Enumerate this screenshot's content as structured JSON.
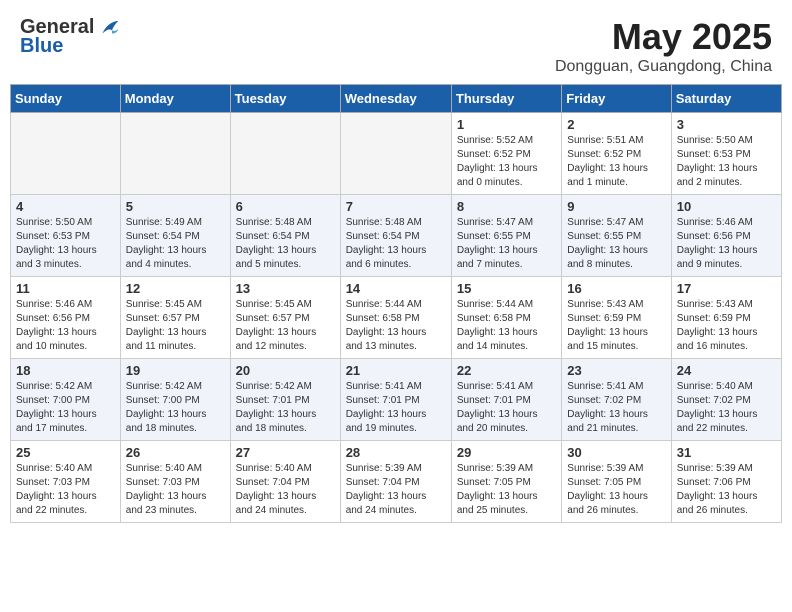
{
  "header": {
    "logo_general": "General",
    "logo_blue": "Blue",
    "month_title": "May 2025",
    "location": "Dongguan, Guangdong, China"
  },
  "days_of_week": [
    "Sunday",
    "Monday",
    "Tuesday",
    "Wednesday",
    "Thursday",
    "Friday",
    "Saturday"
  ],
  "weeks": [
    [
      {
        "day": "",
        "info": ""
      },
      {
        "day": "",
        "info": ""
      },
      {
        "day": "",
        "info": ""
      },
      {
        "day": "",
        "info": ""
      },
      {
        "day": "1",
        "info": "Sunrise: 5:52 AM\nSunset: 6:52 PM\nDaylight: 13 hours\nand 0 minutes."
      },
      {
        "day": "2",
        "info": "Sunrise: 5:51 AM\nSunset: 6:52 PM\nDaylight: 13 hours\nand 1 minute."
      },
      {
        "day": "3",
        "info": "Sunrise: 5:50 AM\nSunset: 6:53 PM\nDaylight: 13 hours\nand 2 minutes."
      }
    ],
    [
      {
        "day": "4",
        "info": "Sunrise: 5:50 AM\nSunset: 6:53 PM\nDaylight: 13 hours\nand 3 minutes."
      },
      {
        "day": "5",
        "info": "Sunrise: 5:49 AM\nSunset: 6:54 PM\nDaylight: 13 hours\nand 4 minutes."
      },
      {
        "day": "6",
        "info": "Sunrise: 5:48 AM\nSunset: 6:54 PM\nDaylight: 13 hours\nand 5 minutes."
      },
      {
        "day": "7",
        "info": "Sunrise: 5:48 AM\nSunset: 6:54 PM\nDaylight: 13 hours\nand 6 minutes."
      },
      {
        "day": "8",
        "info": "Sunrise: 5:47 AM\nSunset: 6:55 PM\nDaylight: 13 hours\nand 7 minutes."
      },
      {
        "day": "9",
        "info": "Sunrise: 5:47 AM\nSunset: 6:55 PM\nDaylight: 13 hours\nand 8 minutes."
      },
      {
        "day": "10",
        "info": "Sunrise: 5:46 AM\nSunset: 6:56 PM\nDaylight: 13 hours\nand 9 minutes."
      }
    ],
    [
      {
        "day": "11",
        "info": "Sunrise: 5:46 AM\nSunset: 6:56 PM\nDaylight: 13 hours\nand 10 minutes."
      },
      {
        "day": "12",
        "info": "Sunrise: 5:45 AM\nSunset: 6:57 PM\nDaylight: 13 hours\nand 11 minutes."
      },
      {
        "day": "13",
        "info": "Sunrise: 5:45 AM\nSunset: 6:57 PM\nDaylight: 13 hours\nand 12 minutes."
      },
      {
        "day": "14",
        "info": "Sunrise: 5:44 AM\nSunset: 6:58 PM\nDaylight: 13 hours\nand 13 minutes."
      },
      {
        "day": "15",
        "info": "Sunrise: 5:44 AM\nSunset: 6:58 PM\nDaylight: 13 hours\nand 14 minutes."
      },
      {
        "day": "16",
        "info": "Sunrise: 5:43 AM\nSunset: 6:59 PM\nDaylight: 13 hours\nand 15 minutes."
      },
      {
        "day": "17",
        "info": "Sunrise: 5:43 AM\nSunset: 6:59 PM\nDaylight: 13 hours\nand 16 minutes."
      }
    ],
    [
      {
        "day": "18",
        "info": "Sunrise: 5:42 AM\nSunset: 7:00 PM\nDaylight: 13 hours\nand 17 minutes."
      },
      {
        "day": "19",
        "info": "Sunrise: 5:42 AM\nSunset: 7:00 PM\nDaylight: 13 hours\nand 18 minutes."
      },
      {
        "day": "20",
        "info": "Sunrise: 5:42 AM\nSunset: 7:01 PM\nDaylight: 13 hours\nand 18 minutes."
      },
      {
        "day": "21",
        "info": "Sunrise: 5:41 AM\nSunset: 7:01 PM\nDaylight: 13 hours\nand 19 minutes."
      },
      {
        "day": "22",
        "info": "Sunrise: 5:41 AM\nSunset: 7:01 PM\nDaylight: 13 hours\nand 20 minutes."
      },
      {
        "day": "23",
        "info": "Sunrise: 5:41 AM\nSunset: 7:02 PM\nDaylight: 13 hours\nand 21 minutes."
      },
      {
        "day": "24",
        "info": "Sunrise: 5:40 AM\nSunset: 7:02 PM\nDaylight: 13 hours\nand 22 minutes."
      }
    ],
    [
      {
        "day": "25",
        "info": "Sunrise: 5:40 AM\nSunset: 7:03 PM\nDaylight: 13 hours\nand 22 minutes."
      },
      {
        "day": "26",
        "info": "Sunrise: 5:40 AM\nSunset: 7:03 PM\nDaylight: 13 hours\nand 23 minutes."
      },
      {
        "day": "27",
        "info": "Sunrise: 5:40 AM\nSunset: 7:04 PM\nDaylight: 13 hours\nand 24 minutes."
      },
      {
        "day": "28",
        "info": "Sunrise: 5:39 AM\nSunset: 7:04 PM\nDaylight: 13 hours\nand 24 minutes."
      },
      {
        "day": "29",
        "info": "Sunrise: 5:39 AM\nSunset: 7:05 PM\nDaylight: 13 hours\nand 25 minutes."
      },
      {
        "day": "30",
        "info": "Sunrise: 5:39 AM\nSunset: 7:05 PM\nDaylight: 13 hours\nand 26 minutes."
      },
      {
        "day": "31",
        "info": "Sunrise: 5:39 AM\nSunset: 7:06 PM\nDaylight: 13 hours\nand 26 minutes."
      }
    ]
  ]
}
